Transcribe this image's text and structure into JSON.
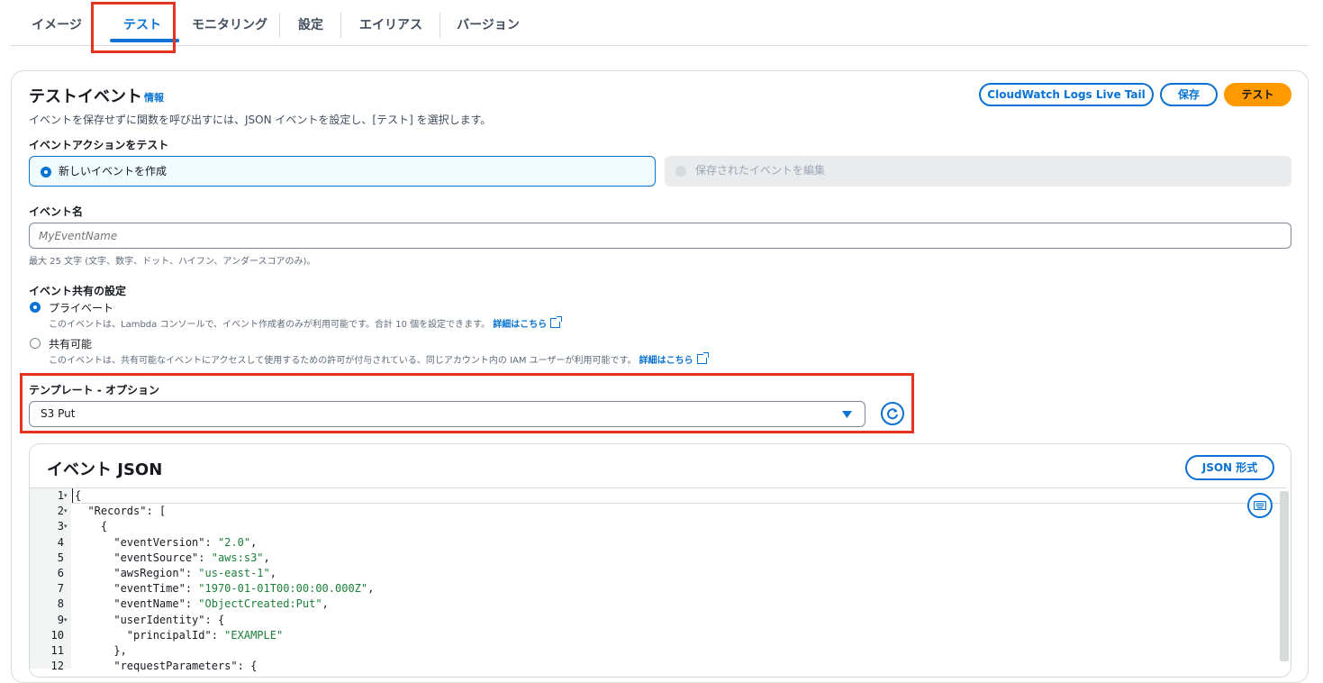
{
  "tabs": [
    "イメージ",
    "テスト",
    "モニタリング",
    "設定",
    "エイリアス",
    "バージョン"
  ],
  "test_event": {
    "title": "テストイベント",
    "info_link": "情報",
    "description": "イベントを保存せずに関数を呼び出すには、JSON イベントを設定し、[テスト] を選択します。",
    "buttons": {
      "live_tail": "CloudWatch Logs Live Tail",
      "save": "保存",
      "test": "テスト"
    },
    "action_label": "イベントアクションをテスト",
    "action_options": {
      "create": "新しいイベントを作成",
      "edit": "保存されたイベントを編集"
    },
    "event_name_label": "イベント名",
    "event_name_placeholder": "MyEventName",
    "event_name_hint": "最大 25 文字 (文字、数字、ドット、ハイフン、アンダースコアのみ)。",
    "sharing_label": "イベント共有の設定",
    "sharing_options": {
      "private": {
        "label": "プライベート",
        "desc": "このイベントは、Lambda コンソールで、イベント作成者のみが利用可能です。合計 10 個を設定できます。"
      },
      "shareable": {
        "label": "共有可能",
        "desc": "このイベントは、共有可能なイベントにアクセスして使用するための許可が付与されている、同じアカウント内の IAM ユーザーが利用可能です。"
      }
    },
    "learn_more": "詳細はこちら",
    "template_label": "テンプレート - オプション",
    "template_value": "S3 Put"
  },
  "event_json": {
    "title": "イベント JSON",
    "format_button": "JSON 形式",
    "line_numbers": [
      "1",
      "2",
      "3",
      "4",
      "5",
      "6",
      "7",
      "8",
      "9",
      "10",
      "11",
      "12"
    ],
    "lines": [
      "{",
      "  \"Records\": [",
      "    {",
      "      \"eventVersion\": \"2.0\",",
      "      \"eventSource\": \"aws:s3\",",
      "      \"awsRegion\": \"us-east-1\",",
      "      \"eventTime\": \"1970-01-01T00:00:00.000Z\",",
      "      \"eventName\": \"ObjectCreated:Put\",",
      "      \"userIdentity\": {",
      "        \"principalId\": \"EXAMPLE\"",
      "      },",
      "      \"requestParameters\": {"
    ]
  },
  "icons": {
    "dropdown": "caret-down-icon",
    "refresh": "refresh-icon",
    "keyboard": "keyboard-icon",
    "external": "external-link-icon"
  },
  "colors": {
    "accent": "#0972d3",
    "primary_button": "#ff9900",
    "highlight_box": "#e3341e",
    "json_string": "#1a7f37"
  }
}
